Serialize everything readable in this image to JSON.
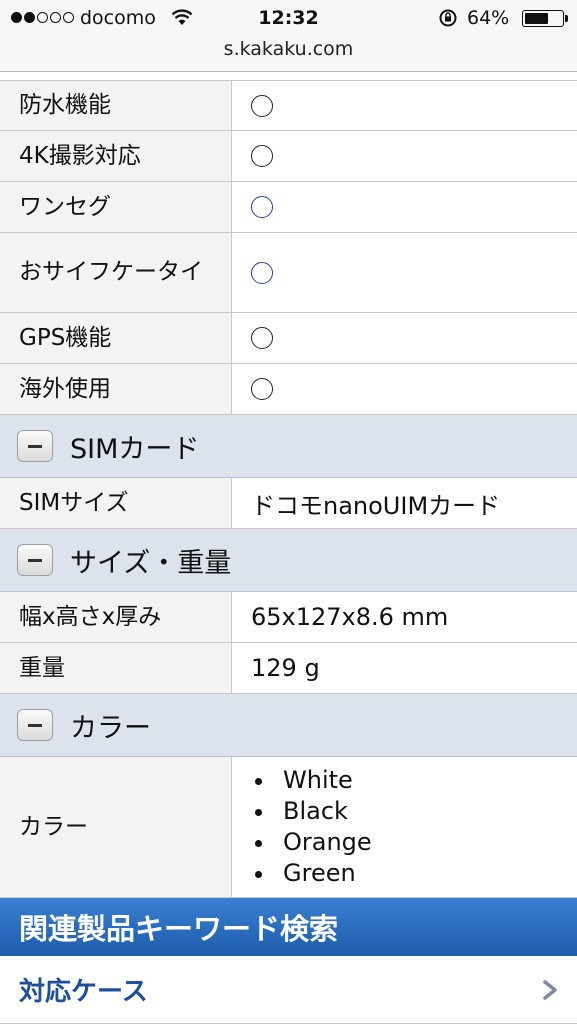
{
  "status_bar": {
    "carrier": "docomo",
    "time": "12:32",
    "battery_percent": "64%",
    "battery_level": 0.64,
    "signal_bars_filled": 2,
    "signal_bars_total": 5
  },
  "url_bar": {
    "url": "s.kakaku.com"
  },
  "feature_rows": [
    {
      "label": "防水機能",
      "mark": "circle"
    },
    {
      "label": "4K撮影対応",
      "mark": "circle"
    },
    {
      "label": "ワンセグ",
      "mark": "circle"
    },
    {
      "label": "おサイフケータイ",
      "mark": "circle"
    },
    {
      "label": "GPS機能",
      "mark": "circle"
    },
    {
      "label": "海外使用",
      "mark": "circle"
    }
  ],
  "sim_section": {
    "title": "SIMカード",
    "rows": [
      {
        "label": "SIMサイズ",
        "value": "ドコモnanoUIMカード"
      }
    ]
  },
  "size_section": {
    "title": "サイズ・重量",
    "rows": [
      {
        "label": "幅x高さx厚み",
        "value": "65x127x8.6 mm"
      },
      {
        "label": "重量",
        "value": "129 g"
      }
    ]
  },
  "color_section": {
    "title": "カラー",
    "label": "カラー",
    "colors": [
      "White",
      "Black",
      "Orange",
      "Green"
    ]
  },
  "keyword_search": {
    "title": "関連製品キーワード検索",
    "link": "対応ケース"
  },
  "theme": {
    "section_bg": "#dde3ed",
    "label_bg": "#f3f3f3",
    "keyword_bar": "#2a6cc0",
    "link_color": "#1d4f9c"
  }
}
